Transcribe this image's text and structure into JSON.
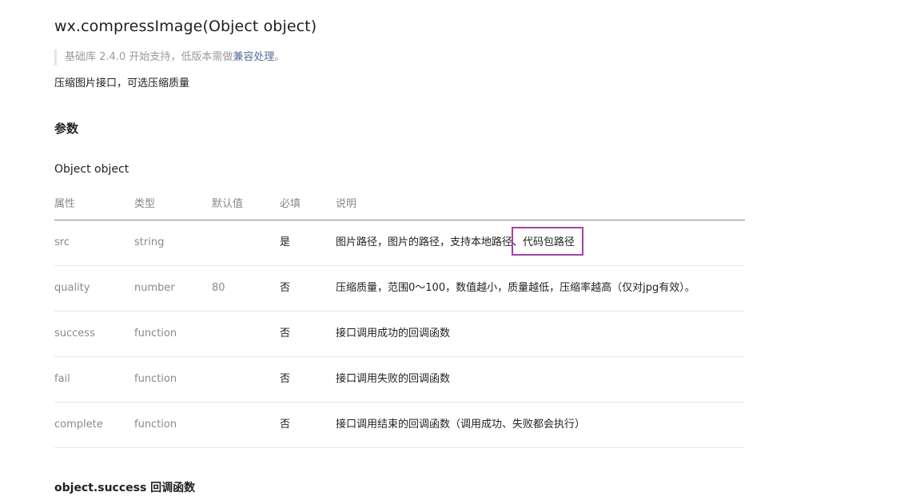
{
  "title": "wx.compressImage(Object object)",
  "note": {
    "prefix": "基础库 2.4.0 开始支持，低版本需做",
    "link": "兼容处理",
    "suffix": "。"
  },
  "description": "压缩图片接口，可选压缩质量",
  "params_heading": "参数",
  "object_heading": "Object object",
  "table": {
    "headers": [
      "属性",
      "类型",
      "默认值",
      "必填",
      "说明"
    ],
    "rows": [
      {
        "name": "src",
        "type": "string",
        "default": "",
        "required": "是",
        "desc": "图片路径，图片的路径，支持本地路径、代码包路径"
      },
      {
        "name": "quality",
        "type": "number",
        "default": "80",
        "required": "否",
        "desc": "压缩质量，范围0～100，数值越小，质量越低，压缩率越高（仅对jpg有效）。"
      },
      {
        "name": "success",
        "type": "function",
        "default": "",
        "required": "否",
        "desc": "接口调用成功的回调函数"
      },
      {
        "name": "fail",
        "type": "function",
        "default": "",
        "required": "否",
        "desc": "接口调用失败的回调函数"
      },
      {
        "name": "complete",
        "type": "function",
        "default": "",
        "required": "否",
        "desc": "接口调用结束的回调函数（调用成功、失败都会执行）"
      }
    ]
  },
  "success_heading": "object.success 回调函数",
  "colors": {
    "link": "#576b95",
    "highlight_border": "#a341a8"
  }
}
